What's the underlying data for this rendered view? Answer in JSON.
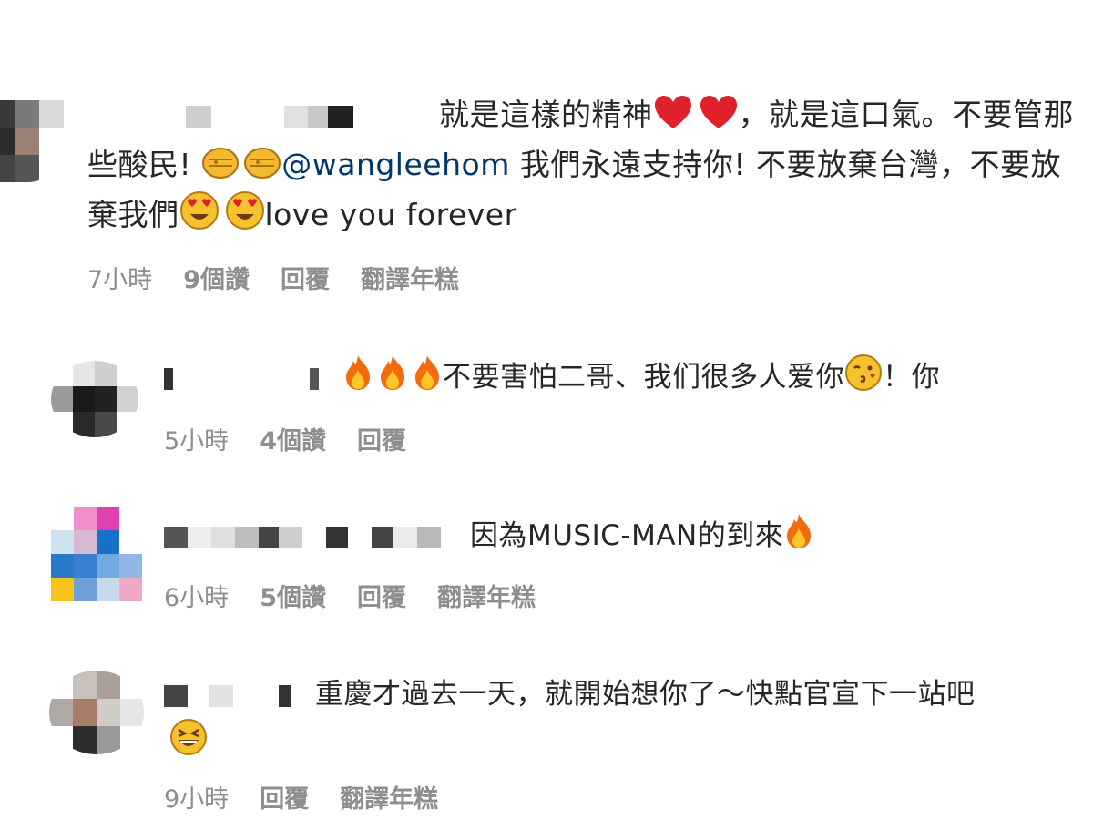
{
  "comments": [
    {
      "text_1": "就是這樣的精神",
      "text_2": "，就是這口氣。不要管那些酸民!",
      "mention": "@wangleehom",
      "text_3": " 我們永遠支持你! 不要放棄台灣，不要放棄我們",
      "text_4": "love you forever",
      "time": "7小時",
      "likes": "9個讚",
      "reply": "回覆",
      "translate": "翻譯年糕"
    },
    {
      "text_1": "不要害怕二哥、我们很多人爱你",
      "text_2": "！你",
      "time": "5小時",
      "likes": "4個讚",
      "reply": "回覆"
    },
    {
      "text_1": "因為MUSIC-MAN的到來",
      "time": "6小時",
      "likes": "5個讚",
      "reply": "回覆",
      "translate": "翻譯年糕"
    },
    {
      "text_1": "重慶才過去一天，就開始想你了～快點官宣下一站吧",
      "time": "9小時",
      "reply": "回覆",
      "translate": "翻譯年糕"
    }
  ],
  "icons": {
    "heart": "heart-icon",
    "fist": "oncoming-fist-icon",
    "heart_eyes": "heart-eyes-face-icon",
    "fire": "fire-icon",
    "kiss": "face-blowing-kiss-icon",
    "grin": "grinning-squinting-face-icon"
  },
  "colors": {
    "mention": "#00376b",
    "meta": "#8e8e8e",
    "text": "#262626"
  }
}
